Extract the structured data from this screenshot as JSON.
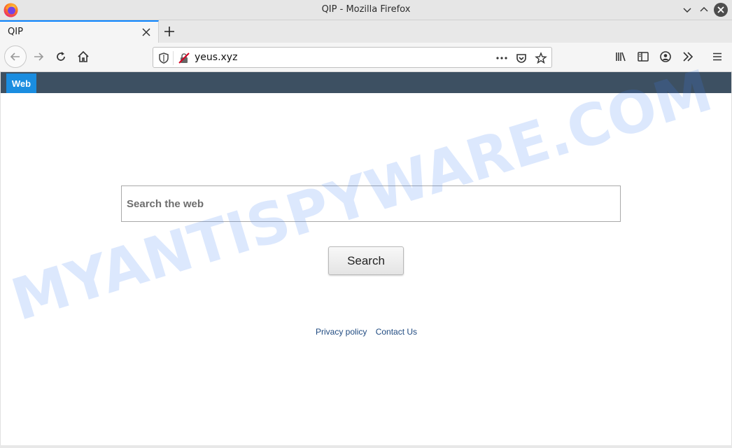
{
  "window": {
    "title": "QIP - Mozilla Firefox"
  },
  "tabs": [
    {
      "title": "QIP"
    }
  ],
  "navbar": {
    "url": "yeus.xyz"
  },
  "site": {
    "nav_tab": "Web",
    "search_placeholder": "Search the web",
    "search_button": "Search",
    "footer_links": [
      "Privacy policy",
      "Contact Us"
    ]
  },
  "watermark": {
    "text": "MYANTISPYWARE.COM",
    "color": "#3b82f6"
  },
  "colors": {
    "tab_accent": "#0a84ff",
    "site_nav_bg": "#3d5062",
    "web_tab": "#1a8de0"
  }
}
